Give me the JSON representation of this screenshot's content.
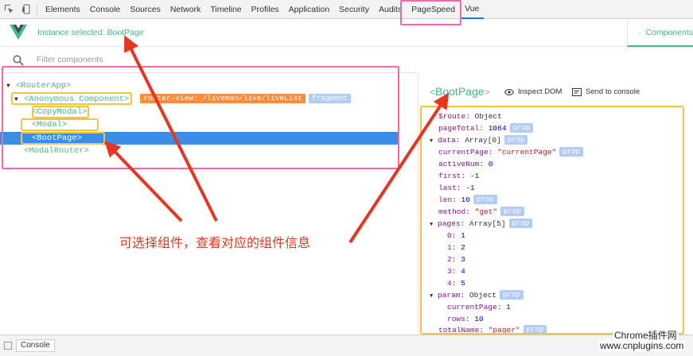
{
  "devtools": {
    "tabs": [
      "Elements",
      "Console",
      "Sources",
      "Network",
      "Timeline",
      "Profiles",
      "Application",
      "Security",
      "Audits",
      "PageSpeed",
      "Vue"
    ],
    "active_tab": "Vue"
  },
  "vue_header": {
    "instance_selected": "Instance selected: BootPage",
    "components_tab": "Components"
  },
  "filter": {
    "placeholder": "Filter components"
  },
  "tree": {
    "router_app": "<RouterApp>",
    "anonymous": "<Anonymous Component>",
    "route_badge": "router-view: /liveman/live/liveList",
    "fragment_badge": "fragment",
    "copy_modal": "<CopyModal>",
    "modal": "<Modal>",
    "boot_page": "<BootPage>",
    "modal_router": "<ModalRouter>"
  },
  "detail": {
    "lt": "<",
    "name": "BootPage",
    "gt": ">",
    "inspect_dom": "Inspect DOM",
    "send_to_console": "Send to console",
    "prop_badge": "prop",
    "props": {
      "route_k": "$route:",
      "route_v": "Object",
      "pageTotal_k": "pageTotal:",
      "pageTotal_v": "1064",
      "data_k": "data:",
      "data_v": "Array[0]",
      "currentPage_k": "currentPage:",
      "currentPage_v": "\"currentPage\"",
      "activeNum_k": "activeNum:",
      "activeNum_v": "0",
      "first_k": "first:",
      "first_v": "-1",
      "last_k": "last:",
      "last_v": "-1",
      "len_k": "len:",
      "len_v": "10",
      "method_k": "method:",
      "method_v": "\"get\"",
      "pages_k": "pages:",
      "pages_v": "Array[5]",
      "p0_k": "0:",
      "p0_v": "1",
      "p1_k": "1:",
      "p1_v": "2",
      "p2_k": "2:",
      "p2_v": "3",
      "p3_k": "3:",
      "p3_v": "4",
      "p4_k": "4:",
      "p4_v": "5",
      "param_k": "param:",
      "param_v": "Object",
      "pcur_k": "currentPage:",
      "pcur_v": "1",
      "prows_k": "rows:",
      "prows_v": "10",
      "totalName_k": "totalName:",
      "totalName_v": "\"pager\""
    }
  },
  "annotation": {
    "caption": "可选择组件，查看对应的组件信息"
  },
  "bottom": {
    "console_label": "Console"
  },
  "watermark": {
    "line1": "Chrome插件网",
    "line2": "www.cnplugins.com"
  },
  "colors": {
    "vue_green": "#42b983",
    "selected_blue": "#3a8ee6",
    "annotation_red": "#e8351f",
    "pink_box": "#f06aa8",
    "yellow_box": "#f5c242"
  }
}
